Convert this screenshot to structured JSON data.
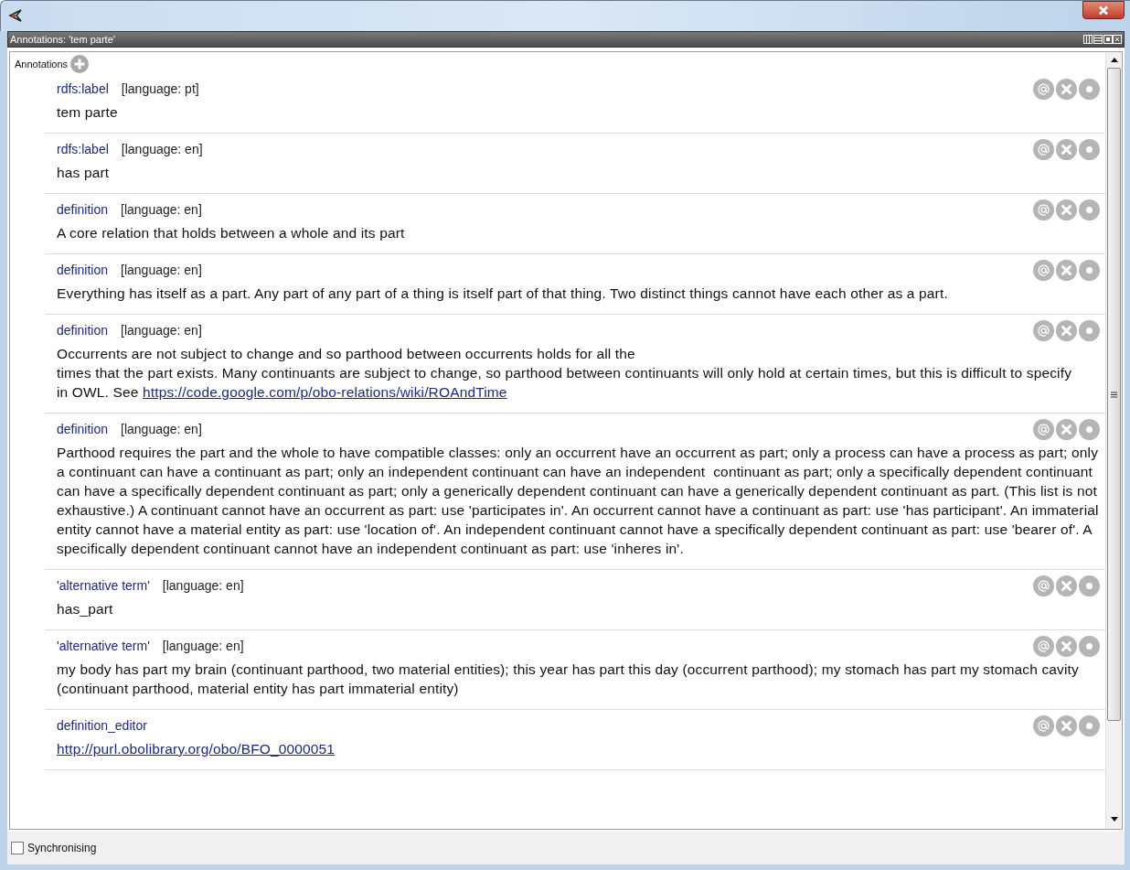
{
  "panel": {
    "title": "Annotations: 'tem parte'"
  },
  "annotations": {
    "heading": "Annotations",
    "items": [
      {
        "property": "rdfs:label",
        "language": "[language: pt]",
        "value": "tem parte"
      },
      {
        "property": "rdfs:label",
        "language": "[language: en]",
        "value": "has part"
      },
      {
        "property": "definition",
        "language": "[language: en]",
        "value": "A core relation that holds between a whole and its part"
      },
      {
        "property": "definition",
        "language": "[language: en]",
        "value": "Everything has itself as a part. Any part of any part of a thing is itself part of that thing. Two distinct things cannot have each other as a part."
      },
      {
        "property": "definition",
        "language": "[language: en]",
        "value": "Occurrents are not subject to change and so parthood between occurrents holds for all the\ntimes that the part exists. Many continuants are subject to change, so parthood between continuants will only hold at certain times, but this is difficult to specify\nin OWL. See ",
        "link": "https://code.google.com/p/obo-relations/wiki/ROAndTime"
      },
      {
        "property": "definition",
        "language": "[language: en]",
        "value": "Parthood requires the part and the whole to have compatible classes: only an occurrent have an occurrent as part; only a process can have a process as part; only a continuant can have a continuant as part; only an independent continuant can have an independent  continuant as part; only a specifically dependent continuant can have a specifically dependent continuant as part; only a generically dependent continuant can have a generically dependent continuant as part. (This list is not exhaustive.) A continuant cannot have an occurrent as part: use 'participates in'. An occurrent cannot have a continuant as part: use 'has participant'. An immaterial entity cannot have a material entity as part: use 'location of'. An independent continuant cannot have a specifically dependent continuant as part: use 'bearer of'. A specifically dependent continuant cannot have an independent continuant as part: use 'inheres in'."
      },
      {
        "property": "'alternative term'",
        "language": "[language: en]",
        "value": "has_part"
      },
      {
        "property": "'alternative term'",
        "language": "[language: en]",
        "value": "my body has part my brain (continuant parthood, two material entities); this year has part this day (occurrent parthood); my stomach has part my stomach cavity (continuant parthood, material entity has part immaterial entity)"
      },
      {
        "property": "definition_editor",
        "link": "http://purl.obolibrary.org/obo/BFO_0000051"
      }
    ]
  },
  "footer": {
    "label": "Synchronising",
    "checked": false
  }
}
